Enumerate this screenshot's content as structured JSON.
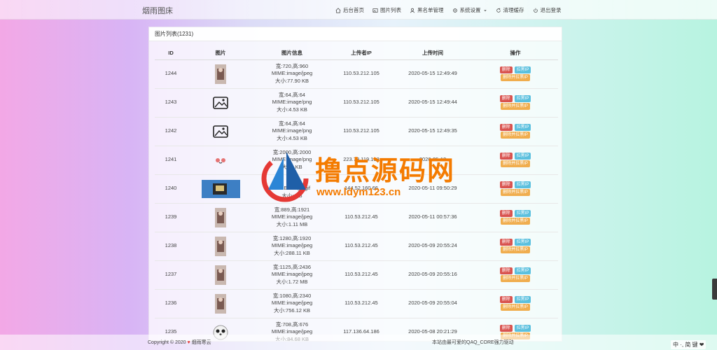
{
  "brand": "烟雨图床",
  "nav": [
    {
      "label": "后台首页",
      "icon": "home-icon"
    },
    {
      "label": "图片列表",
      "icon": "image-icon"
    },
    {
      "label": "黑名单管理",
      "icon": "user-icon"
    },
    {
      "label": "系统设置",
      "icon": "gear-icon"
    },
    {
      "label": "清理缓存",
      "icon": "refresh-icon"
    },
    {
      "label": "退出登录",
      "icon": "power-icon"
    }
  ],
  "panel": {
    "title": "图片列表(1231)"
  },
  "table": {
    "headers": [
      "ID",
      "图片",
      "图片信息",
      "上传者IP",
      "上传时间",
      "操作"
    ],
    "actions": {
      "delete": "删除",
      "ban": "拉黑IP",
      "delete_ban": "删除并拉黑IP"
    },
    "rows": [
      {
        "id": "1244",
        "info1": "宽:720,高:960",
        "info2": "MIME:image/jpeg",
        "info3": "大小:77.90 KB",
        "ip": "110.53.212.105",
        "time": "2020-05-15 12:49:49",
        "thumb": "photo"
      },
      {
        "id": "1243",
        "info1": "宽:64,高:64",
        "info2": "MIME:image/png",
        "info3": "大小:4.53 KB",
        "ip": "110.53.212.105",
        "time": "2020-05-15 12:49:44",
        "thumb": "placeholder"
      },
      {
        "id": "1242",
        "info1": "宽:64,高:64",
        "info2": "MIME:image/png",
        "info3": "大小:4.53 KB",
        "ip": "110.53.212.105",
        "time": "2020-05-15 12:49:35",
        "thumb": "placeholder"
      },
      {
        "id": "1241",
        "info1": "宽:2000,高:2000",
        "info2": "MIME:image/png",
        "info3": "大小: KB",
        "ip": "223.73.119.138",
        "time": "2020-05-12",
        "thumb": "emoji"
      },
      {
        "id": "1240",
        "info1": "宽:",
        "info2": "MIME:image/gif",
        "info3": "大小: KB",
        "ip": "144.52.160.66",
        "time": "2020-05-11 09:50:29",
        "thumb": "wide"
      },
      {
        "id": "1239",
        "info1": "宽:889,高:1921",
        "info2": "MIME:image/jpeg",
        "info3": "大小:1.11 MB",
        "ip": "110.53.212.45",
        "time": "2020-05-11 00:57:36",
        "thumb": "photo"
      },
      {
        "id": "1238",
        "info1": "宽:1280,高:1920",
        "info2": "MIME:image/jpeg",
        "info3": "大小:288.11 KB",
        "ip": "110.53.212.45",
        "time": "2020-05-09 20:55:24",
        "thumb": "photo"
      },
      {
        "id": "1237",
        "info1": "宽:1125,高:2436",
        "info2": "MIME:image/jpeg",
        "info3": "大小:1.72 MB",
        "ip": "110.53.212.45",
        "time": "2020-05-09 20:55:16",
        "thumb": "photo"
      },
      {
        "id": "1236",
        "info1": "宽:1080,高:2340",
        "info2": "MIME:image/jpeg",
        "info3": "大小:756.12 KB",
        "ip": "110.53.212.45",
        "time": "2020-05-09 20:55:04",
        "thumb": "photo"
      },
      {
        "id": "1235",
        "info1": "宽:708,高:676",
        "info2": "MIME:image/jpeg",
        "info3": "大小:84.68 KB",
        "ip": "117.136.64.186",
        "time": "2020-05-08 20:21:29",
        "thumb": "panda"
      }
    ]
  },
  "footer": {
    "copyright": "Copyright © 2020",
    "heart": "♥",
    "author": "烟雨寒云",
    "powered": "本站由最可爱的QAQ_CORE强力驱动"
  },
  "watermark": {
    "title": "撸点源码网",
    "url": "www.ldym123.cn"
  },
  "ime": "中 ·, 简 键 ❤",
  "colors": {
    "delete": "#d9534f",
    "ban": "#5bc0de",
    "delete_ban": "#f0ad4e",
    "watermark": "#f47b00"
  }
}
